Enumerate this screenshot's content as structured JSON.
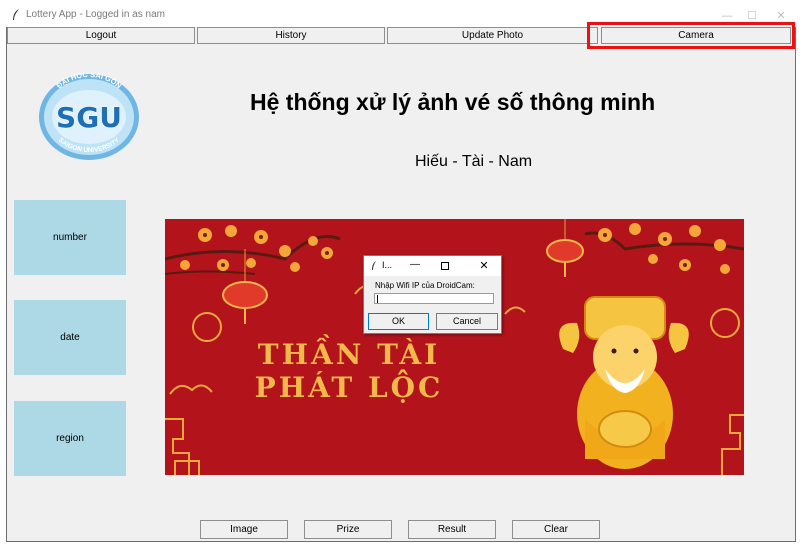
{
  "window": {
    "title": "Lottery App - Logged in as nam",
    "minimize_glyph": "—",
    "maximize_glyph": "☐",
    "close_glyph": "✕"
  },
  "toolbar": {
    "logout_label": "Logout",
    "history_label": "History",
    "update_photo_label": "Update Photo",
    "camera_label": "Camera"
  },
  "logo": {
    "top_text": "ĐẠI HỌC SÀI GÒN",
    "center_text": "SGU",
    "bottom_text": "SAIGON UNIVERSITY"
  },
  "header": {
    "title": "Hệ thống xử lý ảnh vé số thông minh",
    "authors": "Hiếu - Tài - Nam"
  },
  "sidebar": {
    "number_label": "number",
    "date_label": "date",
    "region_label": "region"
  },
  "banner": {
    "line1": "THẦN TÀI",
    "line2": "PHÁT LỘC"
  },
  "dialog": {
    "title": "I...",
    "prompt": "Nhập Wifi IP của DroidCam:",
    "ip_value": "",
    "ok_label": "OK",
    "cancel_label": "Cancel"
  },
  "actions": {
    "image_label": "Image",
    "prize_label": "Prize",
    "result_label": "Result",
    "clear_label": "Clear"
  },
  "colors": {
    "highlight": "#ee1111",
    "sidebox": "#add8e6",
    "banner_red": "#b0121b",
    "gold": "#f5c542"
  },
  "icons": [
    "feather-icon",
    "minimize-icon",
    "maximize-icon",
    "close-icon"
  ]
}
